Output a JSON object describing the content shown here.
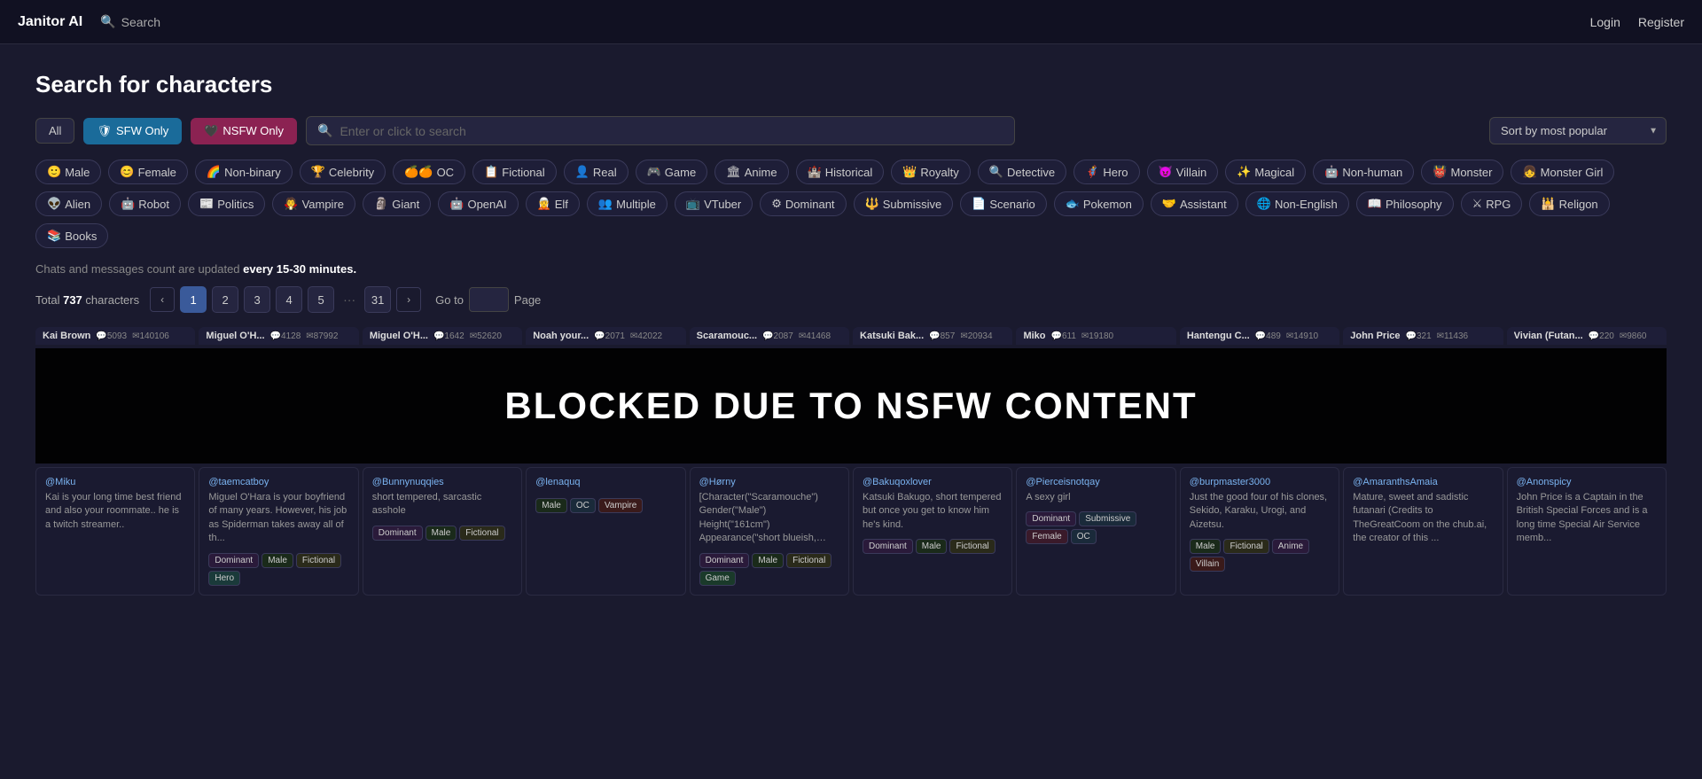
{
  "header": {
    "logo": "Janitor AI",
    "search_label": "Search",
    "login_label": "Login",
    "register_label": "Register"
  },
  "page": {
    "title": "Search for characters",
    "search_placeholder": "Enter or click to search",
    "info_text_prefix": "Chats and messages count are updated ",
    "info_text_emphasis": "every 15-30 minutes.",
    "total_label": "Total",
    "total_count": "737",
    "chars_label": "characters",
    "goto_label": "Go to",
    "page_label": "Page"
  },
  "filters": {
    "all_label": "All",
    "sfw_label": "SFW Only",
    "nsfw_label": "NSFW Only"
  },
  "sort": {
    "label": "Sort by most popular"
  },
  "categories": [
    {
      "emoji": "🙂",
      "label": "Male"
    },
    {
      "emoji": "😊",
      "label": "Female"
    },
    {
      "emoji": "🌈",
      "label": "Non-binary"
    },
    {
      "emoji": "🏆",
      "label": "Celebrity"
    },
    {
      "emoji": "🍊🍊",
      "label": "OC"
    },
    {
      "emoji": "📋",
      "label": "Fictional"
    },
    {
      "emoji": "👤",
      "label": "Real"
    },
    {
      "emoji": "🎮",
      "label": "Game"
    },
    {
      "emoji": "🏛",
      "label": "Anime"
    },
    {
      "emoji": "🏰",
      "label": "Historical"
    },
    {
      "emoji": "👑",
      "label": "Royalty"
    },
    {
      "emoji": "🔍",
      "label": "Detective"
    },
    {
      "emoji": "🦸",
      "label": "Hero"
    },
    {
      "emoji": "😈",
      "label": "Villain"
    },
    {
      "emoji": "✨",
      "label": "Magical"
    },
    {
      "emoji": "🤖",
      "label": "Non-human"
    },
    {
      "emoji": "👹",
      "label": "Monster"
    },
    {
      "emoji": "👧",
      "label": "Monster Girl"
    },
    {
      "emoji": "👽",
      "label": "Alien"
    },
    {
      "emoji": "🤖",
      "label": "Robot"
    },
    {
      "emoji": "📰",
      "label": "Politics"
    },
    {
      "emoji": "🧛",
      "label": "Vampire"
    },
    {
      "emoji": "🗿",
      "label": "Giant"
    },
    {
      "emoji": "🤖",
      "label": "OpenAI"
    },
    {
      "emoji": "🧝",
      "label": "Elf"
    },
    {
      "emoji": "👥",
      "label": "Multiple"
    },
    {
      "emoji": "📺",
      "label": "VTuber"
    },
    {
      "emoji": "⚙",
      "label": "Dominant"
    },
    {
      "emoji": "🔱",
      "label": "Submissive"
    },
    {
      "emoji": "📄",
      "label": "Scenario"
    },
    {
      "emoji": "🐟",
      "label": "Pokemon"
    },
    {
      "emoji": "🤝",
      "label": "Assistant"
    },
    {
      "emoji": "🌐",
      "label": "Non-English"
    },
    {
      "emoji": "📖",
      "label": "Philosophy"
    },
    {
      "emoji": "⚔",
      "label": "RPG"
    },
    {
      "emoji": "🕌",
      "label": "Religon"
    },
    {
      "emoji": "📚",
      "label": "Books"
    }
  ],
  "pagination": {
    "pages": [
      "1",
      "2",
      "3",
      "4",
      "5"
    ],
    "last_page": "31",
    "active_page": "1"
  },
  "strip_chars": [
    {
      "name": "Kai Brown",
      "chats": "5093",
      "msgs": "140106"
    },
    {
      "name": "Miguel O'H...",
      "chats": "4128",
      "msgs": "87992"
    },
    {
      "name": "Miguel O'H...",
      "chats": "1642",
      "msgs": "52620"
    },
    {
      "name": "Noah your...",
      "chats": "2071",
      "msgs": "42022"
    },
    {
      "name": "Scaramouc...",
      "chats": "2087",
      "msgs": "41468"
    },
    {
      "name": "Katsuki Bak...",
      "chats": "857",
      "msgs": "20934"
    },
    {
      "name": "Miko",
      "chats": "611",
      "msgs": "19180"
    },
    {
      "name": "Hantengu C...",
      "chats": "489",
      "msgs": "14910"
    },
    {
      "name": "John Price",
      "chats": "321",
      "msgs": "11436"
    },
    {
      "name": "Vivian (Futan...",
      "chats": "220",
      "msgs": "9860"
    }
  ],
  "blocked_text": "BLOCKED DUE TO NSFW CONTENT",
  "cards": [
    {
      "author": "@Miku",
      "description": "Kai is your long time best friend and also your roommate.. he is a twitch streamer..",
      "tags": []
    },
    {
      "author": "@taemcatboy",
      "description": "Miguel O'Hara is your boyfriend of many years. However, his job as Spiderman takes away all of th...",
      "tags": [
        "Dominant",
        "Male",
        "Fictional",
        "Hero"
      ]
    },
    {
      "author": "@Bunnynuqqies",
      "description": "short tempered, sarcastic asshole",
      "tags": [
        "Dominant",
        "Male",
        "Fictional"
      ]
    },
    {
      "author": "@lenaquq",
      "description": "",
      "tags": [
        "Male",
        "OC",
        "Vampire"
      ]
    },
    {
      "author": "@Hørny",
      "description": "[Character(\"Scaramouche\") Gender(\"Male\") Height(\"161cm\") Appearance(\"short blueish, black hai...",
      "tags": [
        "Dominant",
        "Male",
        "Fictional",
        "Game"
      ]
    },
    {
      "author": "@Bakuqoxlover",
      "description": "Katsuki Bakugo, short tempered but once you get to know him he's kind.",
      "tags": [
        "Dominant",
        "Male",
        "Fictional"
      ]
    },
    {
      "author": "@Pierceisnotqay",
      "description": "A sexy girl",
      "tags": [
        "Dominant",
        "Submissive",
        "Female",
        "OC"
      ]
    },
    {
      "author": "@burpmaster3000",
      "description": "Just the good four of his clones, Sekido, Karaku, Urogi, and Aizetsu.",
      "tags": [
        "Male",
        "Fictional",
        "Anime",
        "Villain"
      ]
    },
    {
      "author": "@AmaranthsAmaia",
      "description": "Mature, sweet and sadistic futanari (Credits to TheGreatCoom on the chub.ai, the creator of this ...",
      "tags": []
    },
    {
      "author": "@Anonspicy",
      "description": "John Price is a Captain in the British Special Forces and is a long time Special Air Service memb...",
      "tags": []
    }
  ]
}
